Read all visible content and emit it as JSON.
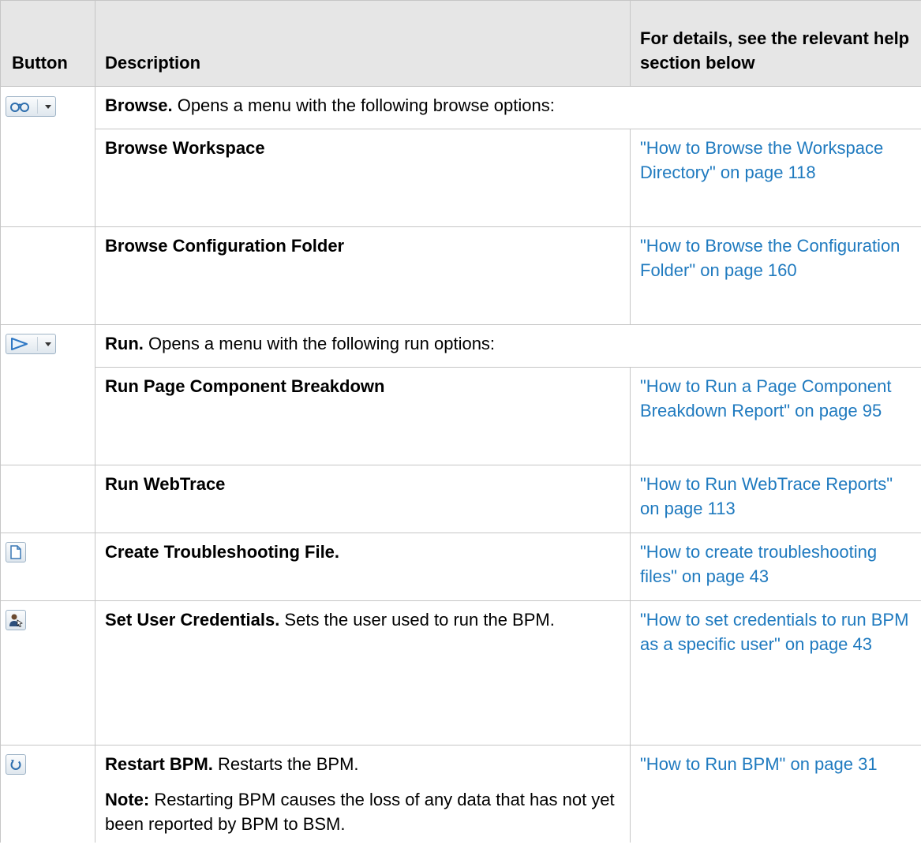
{
  "header": {
    "button": "Button",
    "description": "Description",
    "details": "For details, see the relevant help section below"
  },
  "rows": {
    "browse": {
      "icon": "binoculars-dropdown-icon",
      "title": "Browse.",
      "text": " Opens a menu with the following browse options:",
      "sub": [
        {
          "label": "Browse Workspace",
          "link": "\"How to Browse the Workspace Directory\" on page 118"
        },
        {
          "label": "Browse Configuration Folder",
          "link": "\"How to Browse the Configuration Folder\" on page 160"
        }
      ]
    },
    "run": {
      "icon": "play-dropdown-icon",
      "title": "Run.",
      "text": " Opens a menu with the following run options:",
      "sub": [
        {
          "label": "Run Page Component Breakdown",
          "link": "\"How to Run a Page Component Breakdown Report\" on page 95"
        },
        {
          "label": "Run WebTrace",
          "link": "\"How to Run WebTrace Reports\" on page 113"
        }
      ]
    },
    "troubleshoot": {
      "icon": "document-icon",
      "title": "Create Troubleshooting File.",
      "link": "\"How to create troubleshooting files\" on page 43"
    },
    "credentials": {
      "icon": "user-credentials-icon",
      "title": "Set User Credentials.",
      "text": " Sets the user used to run the BPM.",
      "link": "\"How to set credentials to run BPM as a specific user\" on page 43"
    },
    "restart": {
      "icon": "restart-icon",
      "title": "Restart BPM.",
      "text": " Restarts the BPM.",
      "note_label": "Note:",
      "note_text": " Restarting BPM causes the loss of any data that has not yet been reported by BPM to BSM.",
      "link": "\"How to Run BPM\" on page 31"
    }
  },
  "colors": {
    "link": "#1f7abf",
    "header_bg": "#e6e6e6",
    "border": "#c6c6c6"
  }
}
